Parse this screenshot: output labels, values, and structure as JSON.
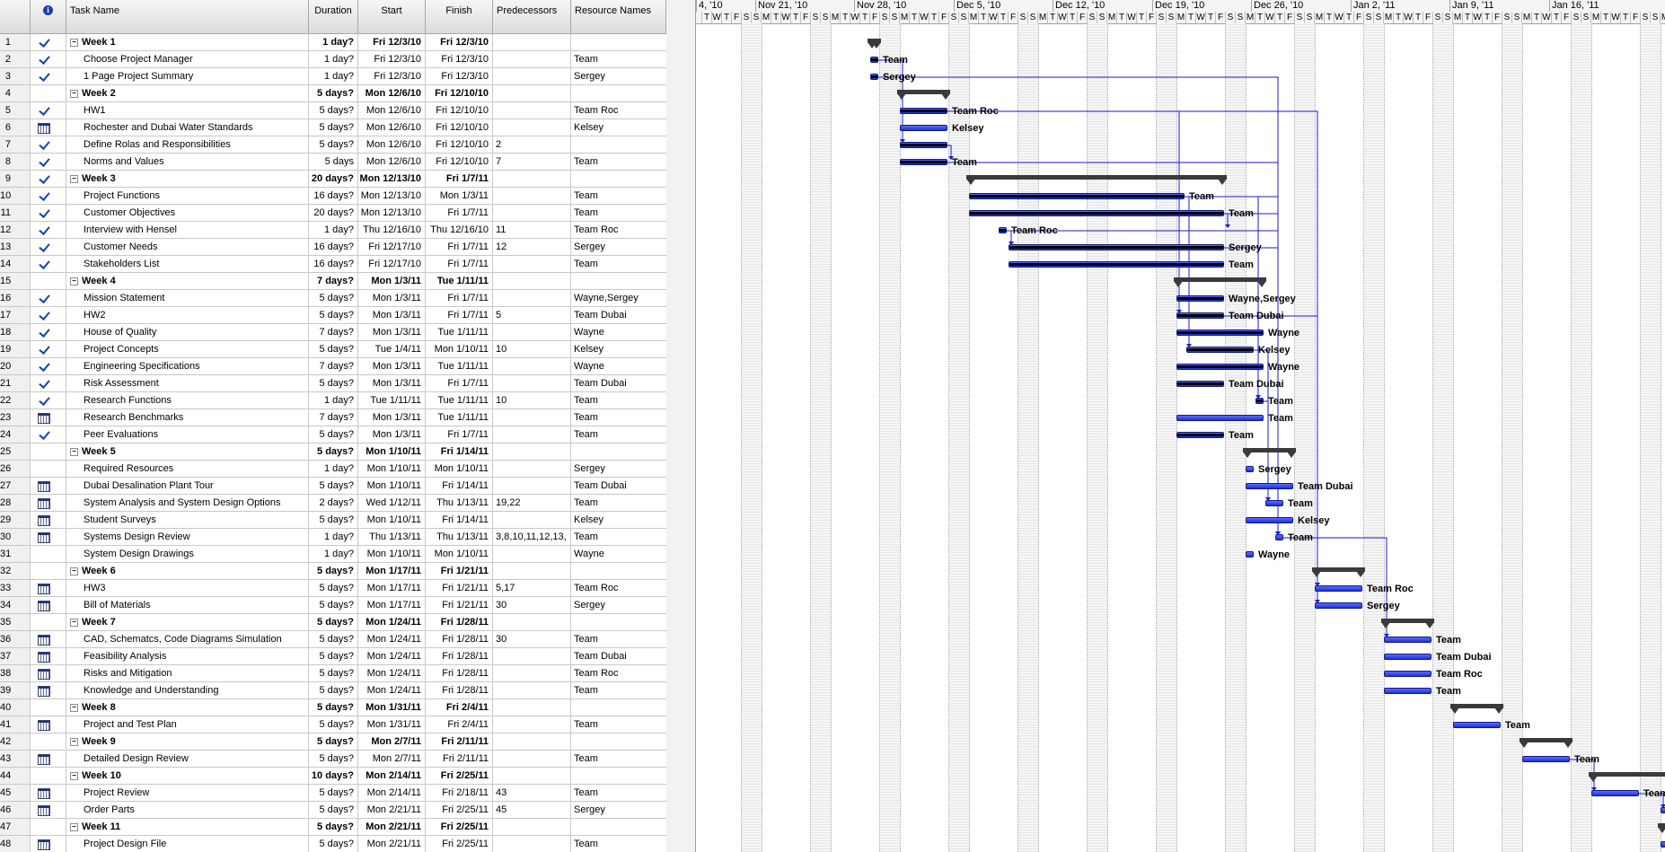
{
  "columns": {
    "indicator_icon": "info-icon",
    "task_name": "Task Name",
    "duration": "Duration",
    "start": "Start",
    "finish": "Finish",
    "predecessors": "Predecessors",
    "resource_names": "Resource Names"
  },
  "timescale": {
    "weeks": [
      "4, '10",
      "Nov 21, '10",
      "Nov 28, '10",
      "Dec 5, '10",
      "Dec 12, '10",
      "Dec 19, '10",
      "Dec 26, '10",
      "Jan 2, '11",
      "Jan 9, '11",
      "Jan 16, '11"
    ],
    "days": [
      "S",
      "M",
      "T",
      "W",
      "T",
      "F",
      "S"
    ]
  },
  "tasks": [
    {
      "id": "1",
      "ind": "check",
      "name": "Week 1",
      "summary": true,
      "dur": "1 day?",
      "start": "Fri 12/3/10",
      "finish": "Fri 12/3/10",
      "pred": "",
      "res": ""
    },
    {
      "id": "2",
      "ind": "check",
      "name": "Choose Project Manager",
      "summary": false,
      "dur": "1 day?",
      "start": "Fri 12/3/10",
      "finish": "Fri 12/3/10",
      "pred": "",
      "res": "Team"
    },
    {
      "id": "3",
      "ind": "check",
      "name": "1 Page Project Summary",
      "summary": false,
      "dur": "1 day?",
      "start": "Fri 12/3/10",
      "finish": "Fri 12/3/10",
      "pred": "",
      "res": "Sergey"
    },
    {
      "id": "4",
      "ind": "",
      "name": "Week 2",
      "summary": true,
      "dur": "5 days?",
      "start": "Mon 12/6/10",
      "finish": "Fri 12/10/10",
      "pred": "",
      "res": ""
    },
    {
      "id": "5",
      "ind": "check",
      "name": "HW1",
      "summary": false,
      "dur": "5 days?",
      "start": "Mon 12/6/10",
      "finish": "Fri 12/10/10",
      "pred": "",
      "res": "Team Roc"
    },
    {
      "id": "6",
      "ind": "calendar",
      "name": "Rochester and Dubai Water Standards",
      "summary": false,
      "dur": "5 days?",
      "start": "Mon 12/6/10",
      "finish": "Fri 12/10/10",
      "pred": "",
      "res": "Kelsey"
    },
    {
      "id": "7",
      "ind": "check",
      "name": "Define Rolas and Responsibilities",
      "summary": false,
      "dur": "5 days?",
      "start": "Mon 12/6/10",
      "finish": "Fri 12/10/10",
      "pred": "2",
      "res": ""
    },
    {
      "id": "8",
      "ind": "check",
      "name": "Norms and Values",
      "summary": false,
      "dur": "5 days",
      "start": "Mon 12/6/10",
      "finish": "Fri 12/10/10",
      "pred": "7",
      "res": "Team"
    },
    {
      "id": "9",
      "ind": "check",
      "name": "Week 3",
      "summary": true,
      "dur": "20 days?",
      "start": "Mon 12/13/10",
      "finish": "Fri 1/7/11",
      "pred": "",
      "res": ""
    },
    {
      "id": "10",
      "ind": "check",
      "name": "Project Functions",
      "summary": false,
      "dur": "16 days?",
      "start": "Mon 12/13/10",
      "finish": "Mon 1/3/11",
      "pred": "",
      "res": "Team"
    },
    {
      "id": "11",
      "ind": "check",
      "name": "Customer Objectives",
      "summary": false,
      "dur": "20 days?",
      "start": "Mon 12/13/10",
      "finish": "Fri 1/7/11",
      "pred": "",
      "res": "Team"
    },
    {
      "id": "12",
      "ind": "check",
      "name": "Interview with Hensel",
      "summary": false,
      "dur": "1 day?",
      "start": "Thu 12/16/10",
      "finish": "Thu 12/16/10",
      "pred": "11",
      "res": "Team Roc"
    },
    {
      "id": "13",
      "ind": "check",
      "name": "Customer Needs",
      "summary": false,
      "dur": "16 days?",
      "start": "Fri 12/17/10",
      "finish": "Fri 1/7/11",
      "pred": "12",
      "res": "Sergey"
    },
    {
      "id": "14",
      "ind": "check",
      "name": "Stakeholders List",
      "summary": false,
      "dur": "16 days?",
      "start": "Fri 12/17/10",
      "finish": "Fri 1/7/11",
      "pred": "",
      "res": "Team"
    },
    {
      "id": "15",
      "ind": "",
      "name": "Week 4",
      "summary": true,
      "dur": "7 days?",
      "start": "Mon 1/3/11",
      "finish": "Tue 1/11/11",
      "pred": "",
      "res": ""
    },
    {
      "id": "16",
      "ind": "check",
      "name": "Mission Statement",
      "summary": false,
      "dur": "5 days?",
      "start": "Mon 1/3/11",
      "finish": "Fri 1/7/11",
      "pred": "",
      "res": "Wayne,Sergey"
    },
    {
      "id": "17",
      "ind": "check",
      "name": "HW2",
      "summary": false,
      "dur": "5 days?",
      "start": "Mon 1/3/11",
      "finish": "Fri 1/7/11",
      "pred": "5",
      "res": "Team Dubai"
    },
    {
      "id": "18",
      "ind": "check",
      "name": "House of Quality",
      "summary": false,
      "dur": "7 days?",
      "start": "Mon 1/3/11",
      "finish": "Tue 1/11/11",
      "pred": "",
      "res": "Wayne"
    },
    {
      "id": "19",
      "ind": "check",
      "name": "Project Concepts",
      "summary": false,
      "dur": "5 days?",
      "start": "Tue 1/4/11",
      "finish": "Mon 1/10/11",
      "pred": "10",
      "res": "Kelsey"
    },
    {
      "id": "20",
      "ind": "check",
      "name": "Engineering Specifications",
      "summary": false,
      "dur": "7 days?",
      "start": "Mon 1/3/11",
      "finish": "Tue 1/11/11",
      "pred": "",
      "res": "Wayne"
    },
    {
      "id": "21",
      "ind": "check",
      "name": "Risk Assessment",
      "summary": false,
      "dur": "5 days?",
      "start": "Mon 1/3/11",
      "finish": "Fri 1/7/11",
      "pred": "",
      "res": "Team Dubai"
    },
    {
      "id": "22",
      "ind": "check",
      "name": "Research Functions",
      "summary": false,
      "dur": "1 day?",
      "start": "Tue 1/11/11",
      "finish": "Tue 1/11/11",
      "pred": "10",
      "res": "Team"
    },
    {
      "id": "23",
      "ind": "calendar",
      "name": "Research Benchmarks",
      "summary": false,
      "dur": "7 days?",
      "start": "Mon 1/3/11",
      "finish": "Tue 1/11/11",
      "pred": "",
      "res": "Team"
    },
    {
      "id": "24",
      "ind": "check",
      "name": "Peer Evaluations",
      "summary": false,
      "dur": "5 days?",
      "start": "Mon 1/3/11",
      "finish": "Fri 1/7/11",
      "pred": "",
      "res": "Team"
    },
    {
      "id": "25",
      "ind": "",
      "name": "Week 5",
      "summary": true,
      "dur": "5 days?",
      "start": "Mon 1/10/11",
      "finish": "Fri 1/14/11",
      "pred": "",
      "res": ""
    },
    {
      "id": "26",
      "ind": "",
      "name": "Required Resources",
      "summary": false,
      "dur": "1 day?",
      "start": "Mon 1/10/11",
      "finish": "Mon 1/10/11",
      "pred": "",
      "res": "Sergey"
    },
    {
      "id": "27",
      "ind": "calendar",
      "name": "Dubai Desalination Plant Tour",
      "summary": false,
      "dur": "5 days?",
      "start": "Mon 1/10/11",
      "finish": "Fri 1/14/11",
      "pred": "",
      "res": "Team Dubai"
    },
    {
      "id": "28",
      "ind": "calendar",
      "name": "System Analysis and System Design Options",
      "summary": false,
      "dur": "2 days?",
      "start": "Wed 1/12/11",
      "finish": "Thu 1/13/11",
      "pred": "19,22",
      "res": "Team"
    },
    {
      "id": "29",
      "ind": "calendar",
      "name": "Student Surveys",
      "summary": false,
      "dur": "5 days?",
      "start": "Mon 1/10/11",
      "finish": "Fri 1/14/11",
      "pred": "",
      "res": "Kelsey"
    },
    {
      "id": "30",
      "ind": "calendar",
      "name": "Systems Design Review",
      "summary": false,
      "dur": "1 day?",
      "start": "Thu 1/13/11",
      "finish": "Thu 1/13/11",
      "pred": "3,8,10,11,12,13,",
      "res": "Team"
    },
    {
      "id": "31",
      "ind": "",
      "name": "System Design Drawings",
      "summary": false,
      "dur": "1 day?",
      "start": "Mon 1/10/11",
      "finish": "Mon 1/10/11",
      "pred": "",
      "res": "Wayne"
    },
    {
      "id": "32",
      "ind": "",
      "name": "Week 6",
      "summary": true,
      "dur": "5 days?",
      "start": "Mon 1/17/11",
      "finish": "Fri 1/21/11",
      "pred": "",
      "res": ""
    },
    {
      "id": "33",
      "ind": "calendar",
      "name": "HW3",
      "summary": false,
      "dur": "5 days?",
      "start": "Mon 1/17/11",
      "finish": "Fri 1/21/11",
      "pred": "5,17",
      "res": "Team Roc"
    },
    {
      "id": "34",
      "ind": "calendar",
      "name": "Bill of Materials",
      "summary": false,
      "dur": "5 days?",
      "start": "Mon 1/17/11",
      "finish": "Fri 1/21/11",
      "pred": "30",
      "res": "Sergey"
    },
    {
      "id": "35",
      "ind": "",
      "name": "Week 7",
      "summary": true,
      "dur": "5 days?",
      "start": "Mon 1/24/11",
      "finish": "Fri 1/28/11",
      "pred": "",
      "res": ""
    },
    {
      "id": "36",
      "ind": "calendar",
      "name": "CAD, Schematcs, Code Diagrams Simulation",
      "summary": false,
      "dur": "5 days?",
      "start": "Mon 1/24/11",
      "finish": "Fri 1/28/11",
      "pred": "30",
      "res": "Team"
    },
    {
      "id": "37",
      "ind": "calendar",
      "name": "Feasibility Analysis",
      "summary": false,
      "dur": "5 days?",
      "start": "Mon 1/24/11",
      "finish": "Fri 1/28/11",
      "pred": "",
      "res": "Team Dubai"
    },
    {
      "id": "38",
      "ind": "calendar",
      "name": "Risks and Mitigation",
      "summary": false,
      "dur": "5 days?",
      "start": "Mon 1/24/11",
      "finish": "Fri 1/28/11",
      "pred": "",
      "res": "Team Roc"
    },
    {
      "id": "39",
      "ind": "calendar",
      "name": "Knowledge and Understanding",
      "summary": false,
      "dur": "5 days?",
      "start": "Mon 1/24/11",
      "finish": "Fri 1/28/11",
      "pred": "",
      "res": "Team"
    },
    {
      "id": "40",
      "ind": "",
      "name": "Week 8",
      "summary": true,
      "dur": "5 days?",
      "start": "Mon 1/31/11",
      "finish": "Fri 2/4/11",
      "pred": "",
      "res": ""
    },
    {
      "id": "41",
      "ind": "calendar",
      "name": "Project and Test Plan",
      "summary": false,
      "dur": "5 days?",
      "start": "Mon 1/31/11",
      "finish": "Fri 2/4/11",
      "pred": "",
      "res": "Team"
    },
    {
      "id": "42",
      "ind": "",
      "name": "Week 9",
      "summary": true,
      "dur": "5 days?",
      "start": "Mon 2/7/11",
      "finish": "Fri 2/11/11",
      "pred": "",
      "res": ""
    },
    {
      "id": "43",
      "ind": "calendar",
      "name": "Detailed Design Review",
      "summary": false,
      "dur": "5 days?",
      "start": "Mon 2/7/11",
      "finish": "Fri 2/11/11",
      "pred": "",
      "res": "Team"
    },
    {
      "id": "44",
      "ind": "",
      "name": "Week 10",
      "summary": true,
      "dur": "10 days?",
      "start": "Mon 2/14/11",
      "finish": "Fri 2/25/11",
      "pred": "",
      "res": ""
    },
    {
      "id": "45",
      "ind": "calendar",
      "name": "Project Review",
      "summary": false,
      "dur": "5 days?",
      "start": "Mon 2/14/11",
      "finish": "Fri 2/18/11",
      "pred": "43",
      "res": "Team"
    },
    {
      "id": "46",
      "ind": "calendar",
      "name": "Order Parts",
      "summary": false,
      "dur": "5 days?",
      "start": "Mon 2/21/11",
      "finish": "Fri 2/25/11",
      "pred": "45",
      "res": "Sergey"
    },
    {
      "id": "47",
      "ind": "",
      "name": "Week 11",
      "summary": true,
      "dur": "5 days?",
      "start": "Mon 2/21/11",
      "finish": "Fri 2/25/11",
      "pred": "",
      "res": ""
    },
    {
      "id": "48",
      "ind": "calendar",
      "name": "Project Design File",
      "summary": false,
      "dur": "5 days?",
      "start": "Mon 2/21/11",
      "finish": "Fri 2/25/11",
      "pred": "",
      "res": "Team"
    }
  ],
  "colors": {
    "bar": "#2f3ff0",
    "summary": "#3a3a3a",
    "link": "#1a1ad0",
    "check": "#1a3fb0"
  }
}
